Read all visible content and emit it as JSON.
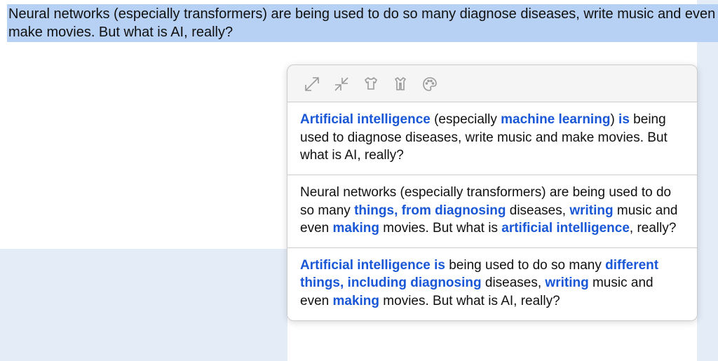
{
  "selected_text": "Neural networks (especially transformers) are being used to do so many diagnose diseases, write music and even make movies. But what is AI, really?",
  "toolbar": {
    "expand": "expand",
    "contract": "contract",
    "tshirt": "casual-tone",
    "coat": "formal-tone",
    "palette": "creative-tone"
  },
  "suggestions": [
    {
      "segments": [
        {
          "t": "Artificial intelligence",
          "hl": true
        },
        {
          "t": " (especially ",
          "hl": false
        },
        {
          "t": "machine learning",
          "hl": true
        },
        {
          "t": ") ",
          "hl": false
        },
        {
          "t": "is",
          "hl": true
        },
        {
          "t": " being used to diagnose diseases, write music and make movies. But what is AI, really?",
          "hl": false
        }
      ]
    },
    {
      "segments": [
        {
          "t": "Neural networks (especially transformers) are being used to do so many ",
          "hl": false
        },
        {
          "t": "things, from diagnosing",
          "hl": true
        },
        {
          "t": " diseases, ",
          "hl": false
        },
        {
          "t": "writing",
          "hl": true
        },
        {
          "t": " music and even ",
          "hl": false
        },
        {
          "t": "making",
          "hl": true
        },
        {
          "t": " movies. But what is ",
          "hl": false
        },
        {
          "t": "artificial intelligence",
          "hl": true
        },
        {
          "t": ", really?",
          "hl": false
        }
      ]
    },
    {
      "segments": [
        {
          "t": "Artificial intelligence is",
          "hl": true
        },
        {
          "t": " being used to do so many ",
          "hl": false
        },
        {
          "t": "different things, including diagnosing",
          "hl": true
        },
        {
          "t": " diseases, ",
          "hl": false
        },
        {
          "t": "writing",
          "hl": true
        },
        {
          "t": " music and even ",
          "hl": false
        },
        {
          "t": "making",
          "hl": true
        },
        {
          "t": " movies. But what is AI, really?",
          "hl": false
        }
      ]
    }
  ]
}
